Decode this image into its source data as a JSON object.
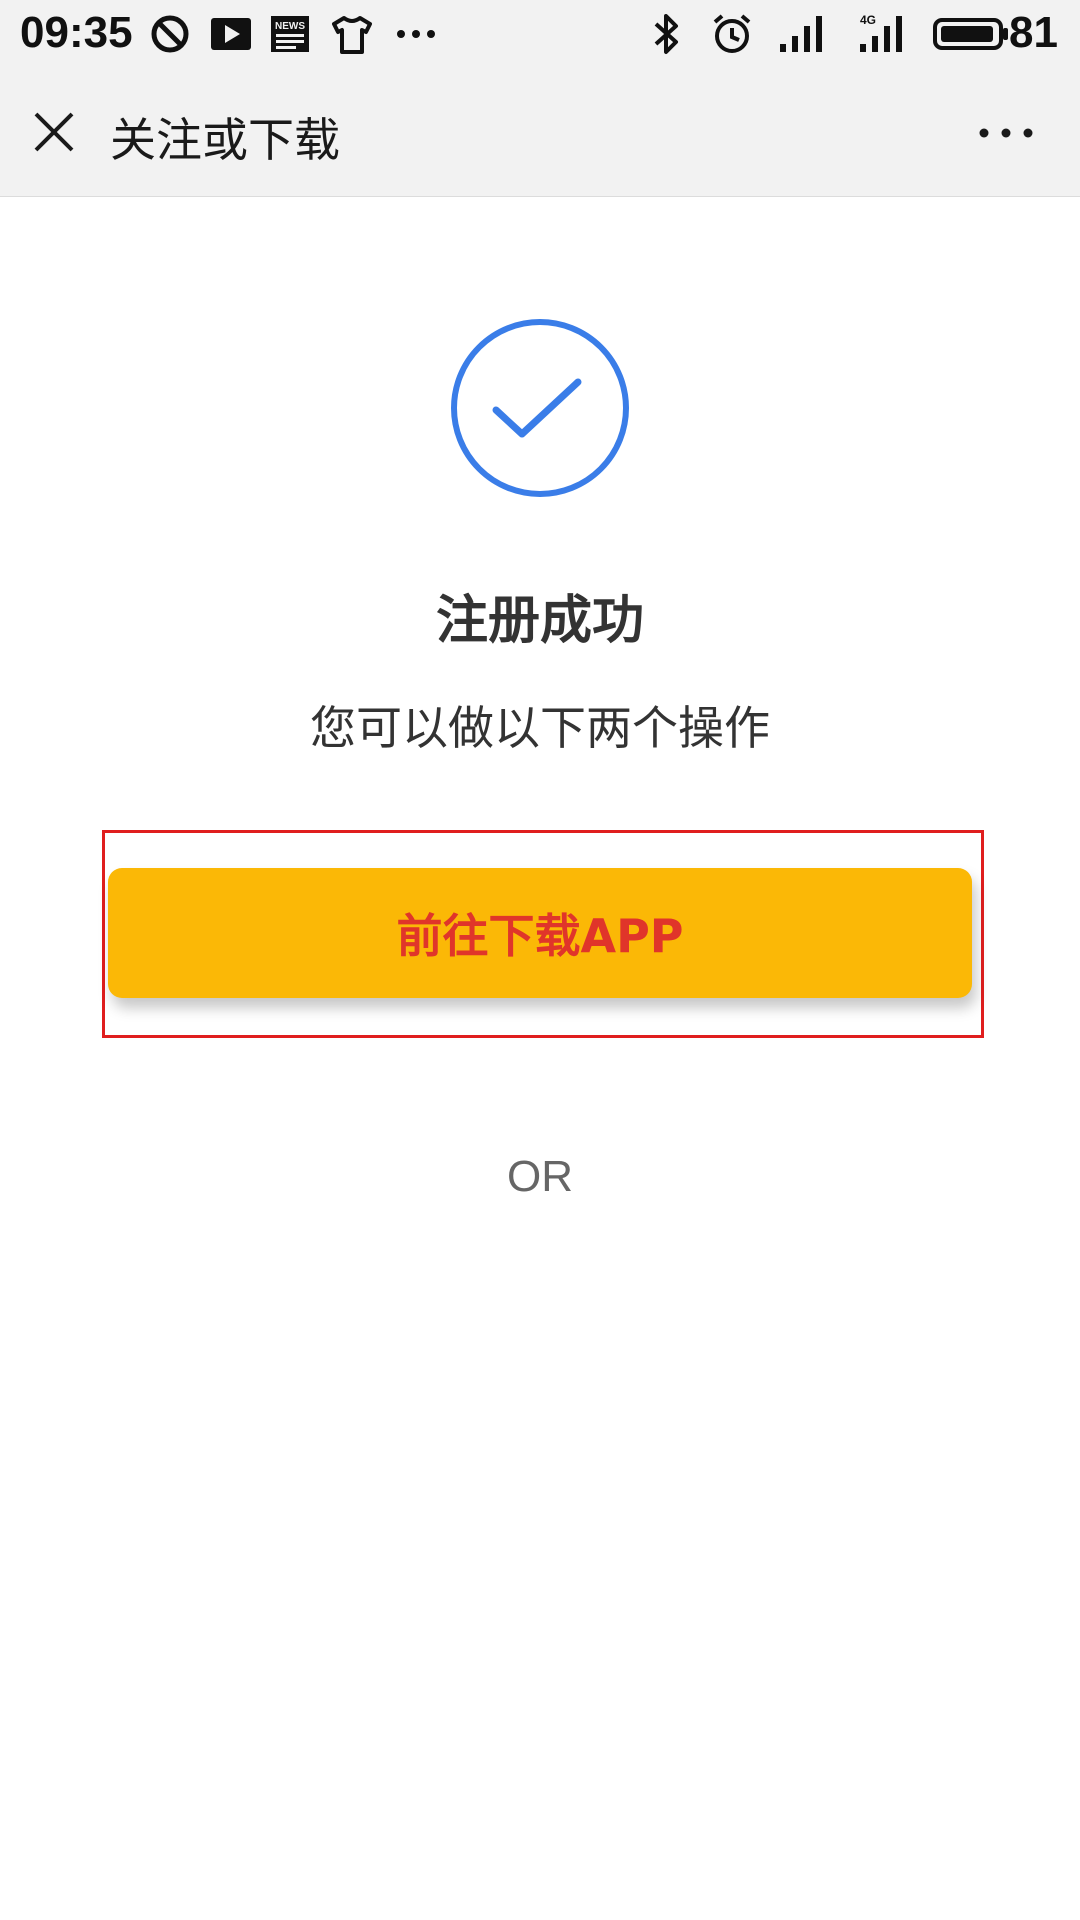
{
  "status_bar": {
    "time": "09:35",
    "battery": "81",
    "network": "4G",
    "icons": [
      "no-disturb-icon",
      "video-play-icon",
      "news-icon",
      "shirt-icon",
      "more-notifications-icon",
      "bluetooth-icon",
      "alarm-icon",
      "signal-icon",
      "signal-4g-icon",
      "battery-icon"
    ]
  },
  "nav": {
    "title": "关注或下载",
    "close_icon": "close-icon",
    "more_icon": "more-icon"
  },
  "main": {
    "title": "注册成功",
    "subtitle": "您可以做以下两个操作",
    "download_button": "前往下载APP",
    "or_text": "OR"
  },
  "colors": {
    "accent_blue": "#3a7de8",
    "button_yellow": "#fbb806",
    "button_text_red": "#e0352a",
    "highlight_red": "#e01e1e",
    "bar_bg": "#f2f2f2"
  }
}
